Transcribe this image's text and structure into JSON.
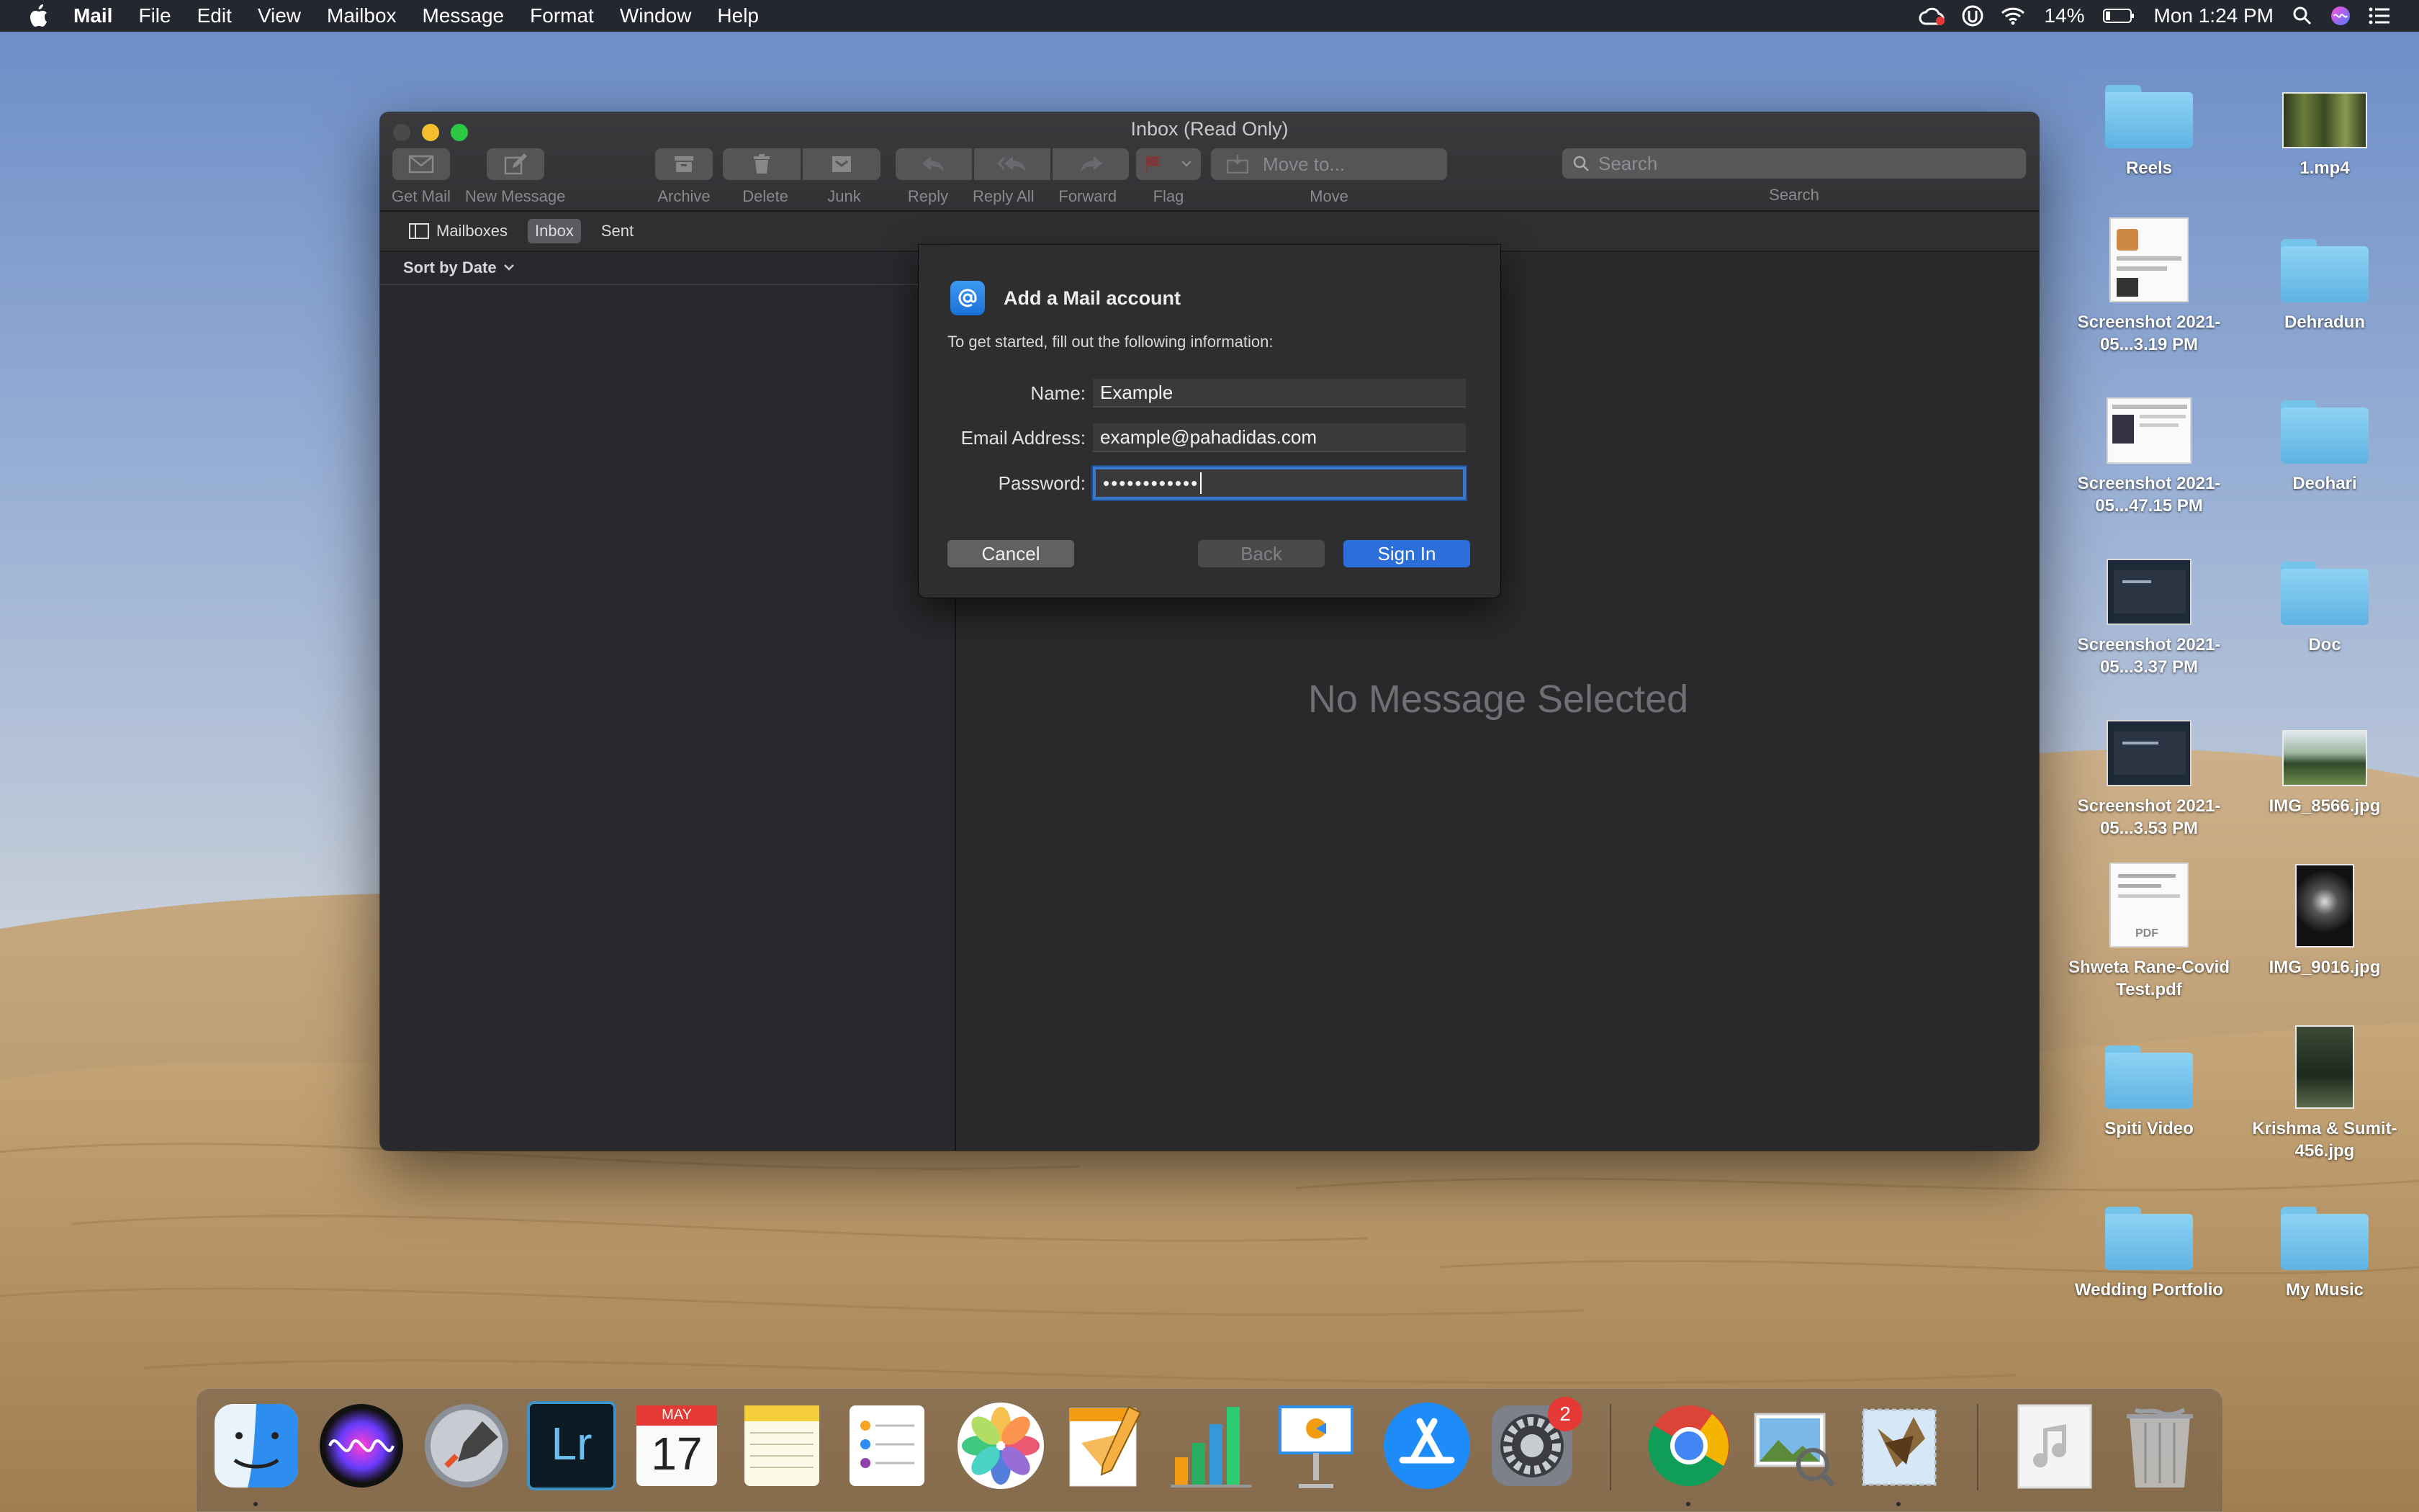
{
  "menubar": {
    "app_name": "Mail",
    "items": [
      "File",
      "Edit",
      "View",
      "Mailbox",
      "Message",
      "Format",
      "Window",
      "Help"
    ],
    "battery": "14%",
    "clock": "Mon 1:24 PM"
  },
  "window": {
    "title": "Inbox (Read Only)",
    "toolbar": {
      "get_mail": "Get Mail",
      "new_message": "New Message",
      "archive": "Archive",
      "delete": "Delete",
      "junk": "Junk",
      "reply": "Reply",
      "reply_all": "Reply All",
      "forward": "Forward",
      "flag": "Flag",
      "move_to": "Move to...",
      "move": "Move",
      "search_placeholder": "Search",
      "search_label": "Search"
    },
    "favorites": {
      "mailboxes": "Mailboxes",
      "inbox": "Inbox",
      "sent": "Sent"
    },
    "sort_label": "Sort by Date",
    "empty_viewer": "No Message Selected"
  },
  "dialog": {
    "title": "Add a Mail account",
    "subtitle": "To get started, fill out the following information:",
    "name_label": "Name:",
    "name_value": "Example",
    "email_label": "Email Address:",
    "email_value": "example@pahadidas.com",
    "password_label": "Password:",
    "password_value": "••••••••••••",
    "cancel": "Cancel",
    "back": "Back",
    "sign_in": "Sign In"
  },
  "desktop": {
    "icons": [
      {
        "label": "Reels",
        "type": "folder"
      },
      {
        "label": "1.mp4",
        "type": "video"
      },
      {
        "label": "Screenshot 2021-05...3.19 PM",
        "type": "screenshot"
      },
      {
        "label": "Dehradun",
        "type": "folder"
      },
      {
        "label": "Screenshot 2021-05...47.15 PM",
        "type": "screenshot"
      },
      {
        "label": "Deohari",
        "type": "folder"
      },
      {
        "label": "Screenshot 2021-05...3.37 PM",
        "type": "screenshot"
      },
      {
        "label": "Doc",
        "type": "folder"
      },
      {
        "label": "Screenshot 2021-05...3.53 PM",
        "type": "screenshot"
      },
      {
        "label": "IMG_8566.jpg",
        "type": "photo"
      },
      {
        "label": "Shweta Rane-Covid Test.pdf",
        "type": "pdf"
      },
      {
        "label": "IMG_9016.jpg",
        "type": "photo"
      },
      {
        "label": "Spiti Video",
        "type": "folder"
      },
      {
        "label": "Krishma & Sumit-456.jpg",
        "type": "photo"
      },
      {
        "label": "Wedding Portfolio",
        "type": "folder"
      },
      {
        "label": "My Music",
        "type": "folder"
      }
    ]
  },
  "dock": {
    "calendar_month": "MAY",
    "calendar_day": "17",
    "lightroom_text": "Lr",
    "system_prefs_badge": "2",
    "apps": [
      "finder",
      "siri",
      "launchpad",
      "lightroom",
      "calendar",
      "notes",
      "reminders",
      "photos",
      "pages",
      "numbers",
      "keynote",
      "app-store",
      "system-preferences",
      "chrome",
      "preview",
      "mail",
      "music",
      "trash"
    ]
  },
  "colors": {
    "accent": "#2c6fdb",
    "window_bg": "#28292c",
    "folder": "#6cc0ea",
    "badge": "#e53935"
  }
}
